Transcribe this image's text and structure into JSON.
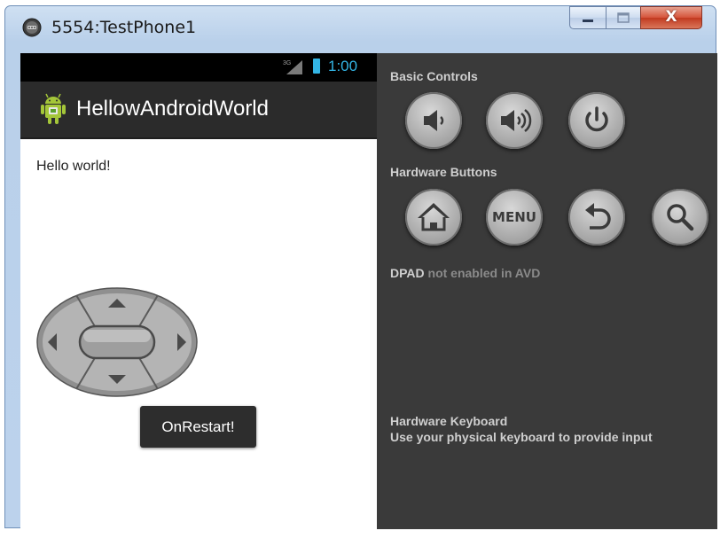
{
  "window": {
    "title": "5554:TestPhone1",
    "close_glyph": "X"
  },
  "phone": {
    "status_time": "1:00",
    "status_network": "3G",
    "app_title": "HellowAndroidWorld",
    "content_text": "Hello world!",
    "toast_text": "OnRestart!"
  },
  "controls": {
    "basic_controls_label": "Basic Controls",
    "basic_buttons": [
      "volume-down-icon",
      "volume-up-icon",
      "power-icon"
    ],
    "hardware_buttons_label": "Hardware Buttons",
    "hardware_buttons": [
      "home-icon",
      "MENU",
      "back-icon",
      "search-icon"
    ],
    "menu_label": "MENU",
    "dpad_label_strong": "DPAD",
    "dpad_label_dim": "not enabled in AVD",
    "keyboard_title": "Hardware Keyboard",
    "keyboard_desc": "Use your physical keyboard to provide input"
  },
  "colors": {
    "status_accent": "#33b5e5",
    "panel_bg": "#3a3a3a",
    "action_bar": "#2b2b2b",
    "android_green": "#a4c639"
  }
}
